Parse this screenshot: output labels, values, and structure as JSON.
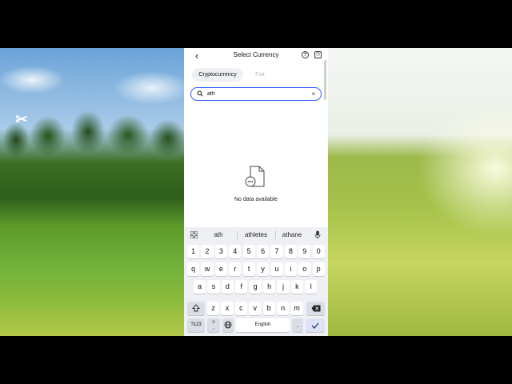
{
  "header": {
    "title": "Select Currency"
  },
  "tabs": {
    "crypto": "Cryptocurrency",
    "fiat": "Fiat"
  },
  "search": {
    "value": "ath"
  },
  "empty": {
    "message": "No data available"
  },
  "keyboard": {
    "suggestions": [
      "ath",
      "athletes",
      "athane"
    ],
    "numbers": [
      "1",
      "2",
      "3",
      "4",
      "5",
      "6",
      "7",
      "8",
      "9",
      "0"
    ],
    "row1": [
      "q",
      "w",
      "e",
      "r",
      "t",
      "y",
      "u",
      "i",
      "o",
      "p"
    ],
    "row2": [
      "a",
      "s",
      "d",
      "f",
      "g",
      "h",
      "j",
      "k",
      "l"
    ],
    "row3": [
      "z",
      "x",
      "c",
      "v",
      "b",
      "n",
      "m"
    ],
    "symbols": "?123",
    "emoji_comma": ",",
    "space": "English",
    "period": "."
  },
  "colors": {
    "accent": "#2f5fff",
    "keyboard_bg": "#eef0f4"
  }
}
